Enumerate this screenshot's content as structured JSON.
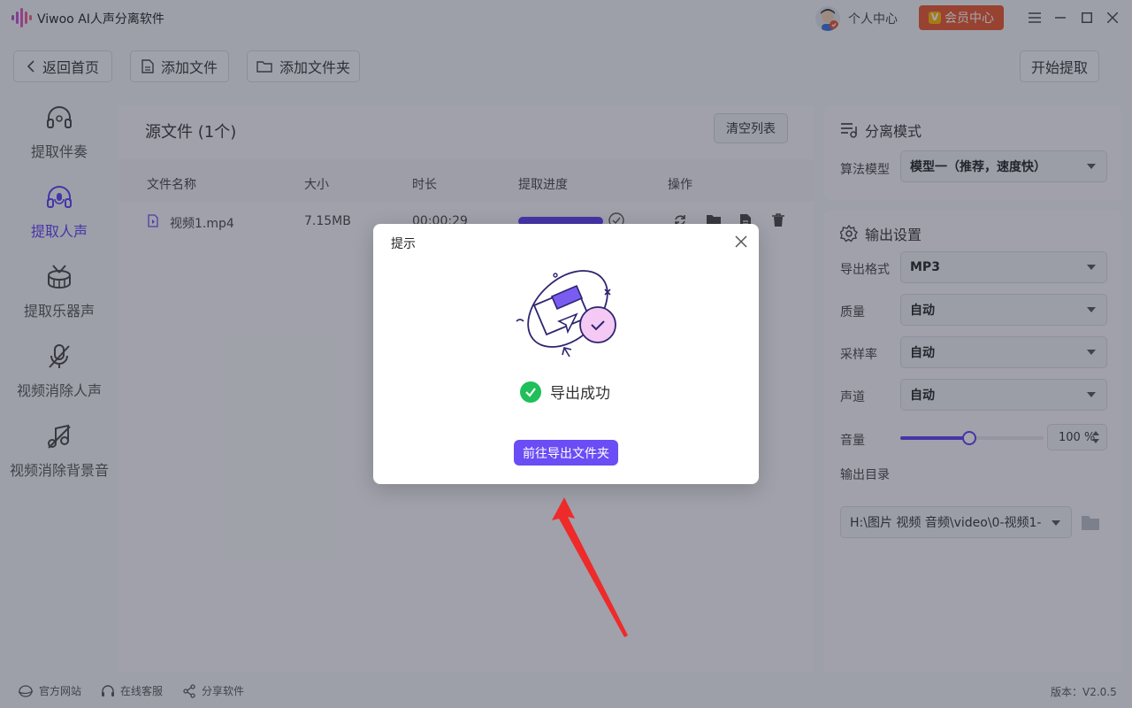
{
  "window": {
    "title": "Viwoo AI人声分离软件",
    "user_center_label": "个人中心",
    "vip_label": "会员中心",
    "vip_badge": "V"
  },
  "toolbar": {
    "back_label": "返回首页",
    "add_file_label": "添加文件",
    "add_folder_label": "添加文件夹",
    "start_label": "开始提取"
  },
  "nav": {
    "items": [
      {
        "label": "提取伴奏",
        "icon": "headphone-icon"
      },
      {
        "label": "提取人声",
        "icon": "headset-mic-icon"
      },
      {
        "label": "提取乐器声",
        "icon": "drum-icon"
      },
      {
        "label": "视频消除人声",
        "icon": "mic-off-icon"
      },
      {
        "label": "视频消除背景音",
        "icon": "music-off-icon"
      }
    ],
    "active_index": 1
  },
  "files": {
    "title": "源文件 (1个)",
    "clear_label": "清空列表",
    "columns": [
      "文件名称",
      "大小",
      "时长",
      "提取进度",
      "操作"
    ],
    "rows": [
      {
        "name": "视频1.mp4",
        "size": "7.15MB",
        "duration": "00:00:29",
        "progress": 1.0
      }
    ]
  },
  "settings": {
    "mode_title": "分离模式",
    "model_label": "算法模型",
    "model_value": "模型一（推荐，速度快）",
    "output_title": "输出设置",
    "format_label": "导出格式",
    "format_value": "MP3",
    "quality_label": "质量",
    "quality_value": "自动",
    "samplerate_label": "采样率",
    "samplerate_value": "自动",
    "channel_label": "声道",
    "channel_value": "自动",
    "volume_label": "音量",
    "volume_value": "100 %",
    "volume_level": 0.48,
    "output_dir_label": "输出目录",
    "output_dir_value": "H:\\图片 视频 音频\\video\\0-视频1-"
  },
  "footer": {
    "website_label": "官方网站",
    "service_label": "在线客服",
    "share_label": "分享软件",
    "version": "版本：V2.0.5"
  },
  "dialog": {
    "title": "提示",
    "message": "导出成功",
    "button_label": "前往导出文件夹"
  },
  "colors": {
    "accent": "#5b3df5",
    "vip": "#e8542a",
    "success": "#1fbf5a",
    "arrow": "#ee2a2a"
  }
}
